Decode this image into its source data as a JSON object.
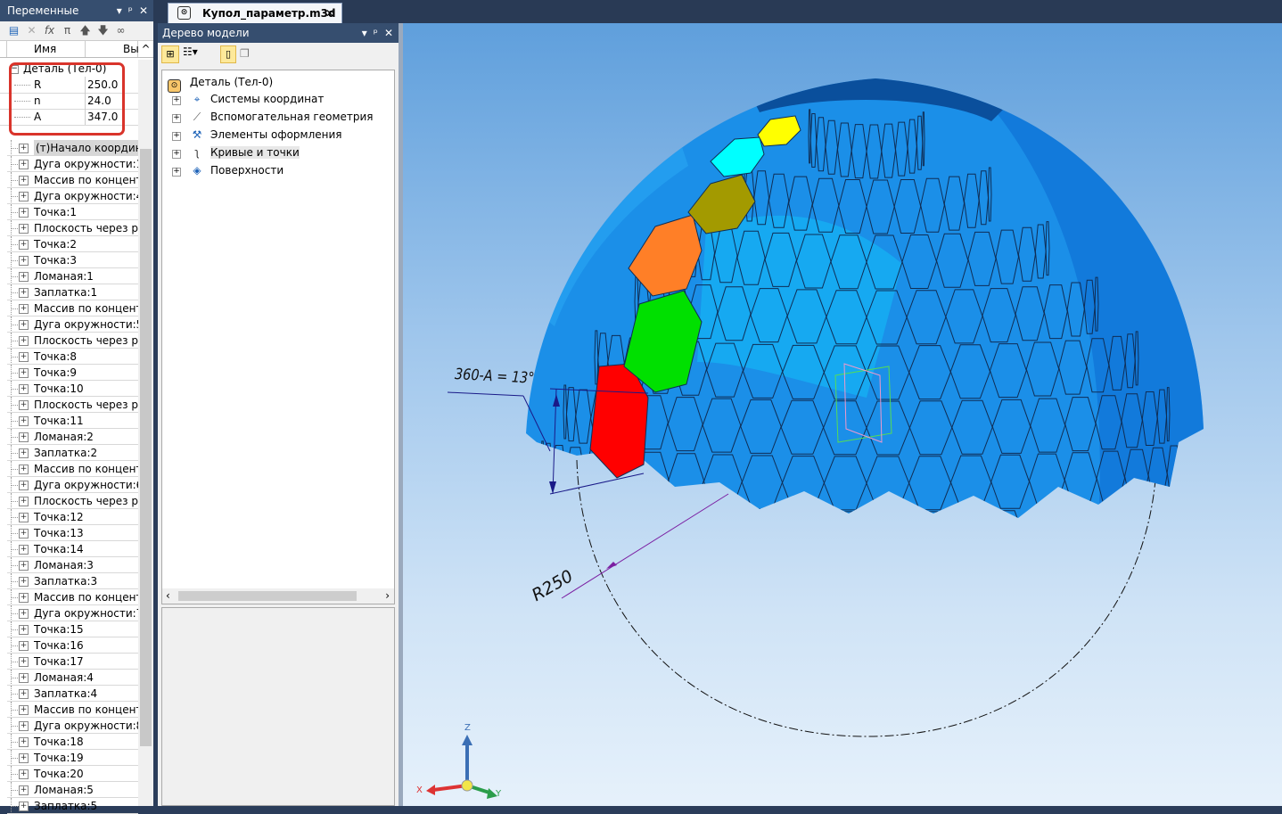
{
  "variables_panel": {
    "title": "Переменные",
    "col_name": "Имя",
    "col_value": "Вы",
    "detail_label": "Деталь (Тел-0)",
    "params": [
      {
        "name": "R",
        "value": "250.0"
      },
      {
        "name": "n",
        "value": "24.0"
      },
      {
        "name": "A",
        "value": "347.0"
      }
    ],
    "items": [
      "(т)Начало координат",
      "Дуга окружности:1",
      "Массив по концентри",
      "Дуга окружности:4",
      "Точка:1",
      "Плоскость через реб",
      "Точка:2",
      "Точка:3",
      "Ломаная:1",
      "Заплатка:1",
      "Массив по концентри",
      "Дуга окружности:5",
      "Плоскость через реб",
      "Точка:8",
      "Точка:9",
      "Точка:10",
      "Плоскость через реб",
      "Точка:11",
      "Ломаная:2",
      "Заплатка:2",
      "Массив по концентри",
      "Дуга окружности:6",
      "Плоскость через реб",
      "Точка:12",
      "Точка:13",
      "Точка:14",
      "Ломаная:3",
      "Заплатка:3",
      "Массив по концентри",
      "Дуга окружности:7",
      "Точка:15",
      "Точка:16",
      "Точка:17",
      "Ломаная:4",
      "Заплатка:4",
      "Массив по концентри",
      "Дуга окружности:8",
      "Точка:18",
      "Точка:19",
      "Точка:20",
      "Ломаная:5",
      "Заплатка:5"
    ],
    "highlight_color": "#d9342b"
  },
  "document_tab": {
    "title": "Купол_параметр.m3d"
  },
  "model_tree": {
    "title": "Дерево модели",
    "root": "Деталь (Тел-0)",
    "nodes": [
      "Системы координат",
      "Вспомогательная геометрия",
      "Элементы оформления",
      "Кривые и точки",
      "Поверхности"
    ]
  },
  "viewport": {
    "annotation_angle": "360-A = 13°",
    "annotation_radius": "R250",
    "axes": {
      "x": "X",
      "y": "Y",
      "z": "Z"
    },
    "colors": {
      "base": "#1b8fe8",
      "dark": "#0b5fb0",
      "red": "#ff0000",
      "green": "#00e000",
      "orange": "#ff7f27",
      "olive": "#a39a00",
      "cyan": "#00ffff",
      "yellow": "#ffff00"
    }
  }
}
